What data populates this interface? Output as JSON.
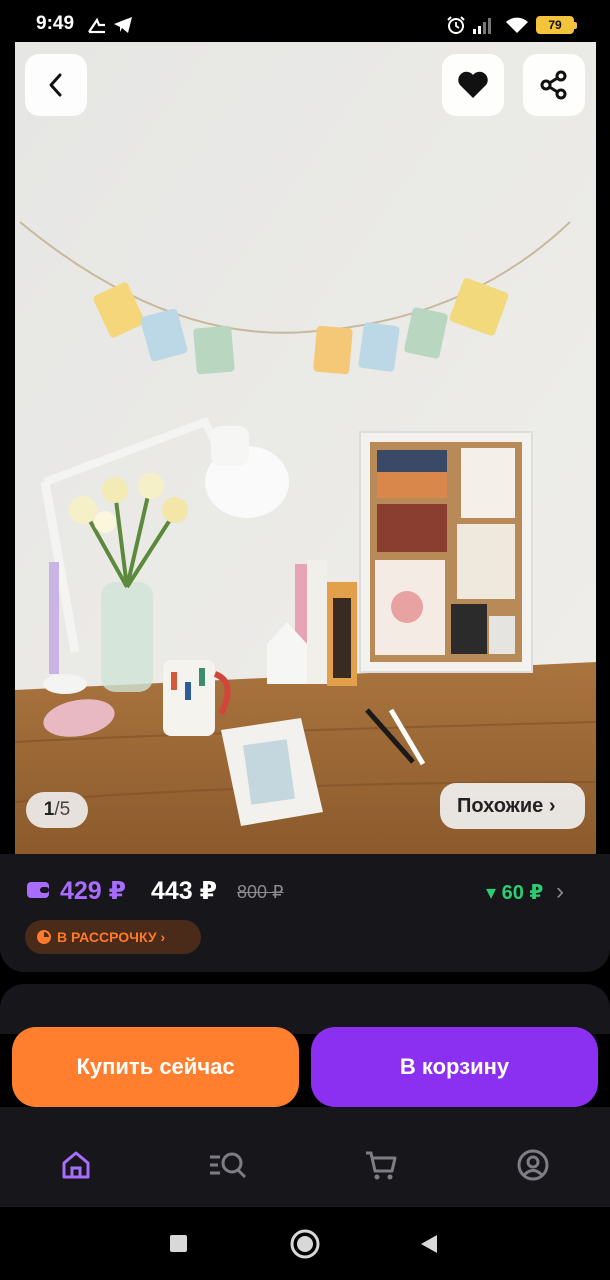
{
  "status_bar": {
    "time": "9:49",
    "battery": "79",
    "icons": [
      "speed-icon",
      "telegram-icon",
      "alarm-icon",
      "signal-icon",
      "wifi-icon",
      "battery-icon"
    ]
  },
  "hero": {
    "counter_current": "1",
    "counter_sep": "/",
    "counter_total": "5",
    "similar_label": "Похожие ›",
    "icons": [
      "back-icon",
      "heart-icon",
      "share-icon"
    ]
  },
  "price": {
    "card_price": "429 ₽",
    "regular_price": "443 ₽",
    "old_price": "800 ₽",
    "cashback": "▾ 60 ₽",
    "cashback_arrow": "›",
    "installment_label": "В РАССРОЧКУ ›",
    "accent_purple": "#a86cff",
    "cashback_green": "#2ecc71"
  },
  "actions": {
    "buy_now": "Купить сейчас",
    "add_to_cart": "В корзину",
    "buy_color": "#ff7f2e",
    "cart_color": "#8b2ff0"
  },
  "bottom_nav": {
    "items": [
      {
        "icon": "home-icon",
        "active": true
      },
      {
        "icon": "catalog-search-icon",
        "active": false
      },
      {
        "icon": "cart-icon",
        "active": false
      },
      {
        "icon": "profile-icon",
        "active": false
      }
    ]
  }
}
